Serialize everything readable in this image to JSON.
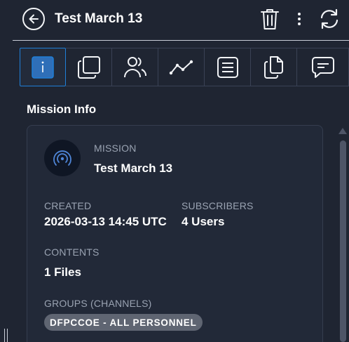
{
  "header": {
    "title": "Test March 13",
    "icons": {
      "back": "arrow-left-circle-icon",
      "delete": "trash-icon",
      "more": "kebab-menu-icon",
      "refresh": "refresh-icon"
    }
  },
  "tabs": [
    {
      "icon": "info-icon",
      "active": true
    },
    {
      "icon": "copy-layers-icon",
      "active": false
    },
    {
      "icon": "users-icon",
      "active": false
    },
    {
      "icon": "line-chart-icon",
      "active": false
    },
    {
      "icon": "list-icon",
      "active": false
    },
    {
      "icon": "files-icon",
      "active": false
    },
    {
      "icon": "chat-icon",
      "active": false
    }
  ],
  "section": {
    "title": "Mission Info"
  },
  "mission": {
    "label": "MISSION",
    "name": "Test March 13",
    "created_label": "CREATED",
    "created": "2026-03-13 14:45 UTC",
    "subscribers_label": "SUBSCRIBERS",
    "subscribers": "4 Users",
    "contents_label": "CONTENTS",
    "contents": "1 Files",
    "groups_label": "GROUPS (CHANNELS)",
    "groups": [
      "DFPCCOE - ALL PERSONNEL"
    ]
  },
  "colors": {
    "background": "#1f2532",
    "accent": "#1f7fd8",
    "chip": "#5f6572",
    "muted_text": "#9aa3b2"
  }
}
